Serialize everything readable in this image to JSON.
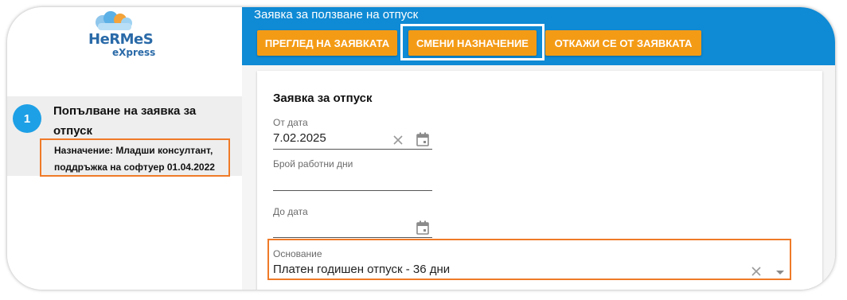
{
  "logo": {
    "name": "HeRMeS",
    "sub": "eXpress"
  },
  "sidebar": {
    "step_number": "1",
    "step_title": "Попълване на заявка за отпуск",
    "assignment_line1": "Назначение: Младши консултант,",
    "assignment_line2": "поддръжка на софтуер 01.04.2022"
  },
  "header": {
    "title": "Заявка за ползване на отпуск",
    "buttons": {
      "review": "ПРЕГЛЕД НА ЗАЯВКАТА",
      "change": "СМЕНИ НАЗНАЧЕНИЕ",
      "cancel": "ОТКАЖИ СЕ ОТ ЗАЯВКАТА"
    }
  },
  "form": {
    "title": "Заявка за отпуск",
    "from_date": {
      "label": "От дата",
      "value": "7.02.2025"
    },
    "work_days": {
      "label": "Брой работни дни",
      "value": ""
    },
    "to_date": {
      "label": "До дата",
      "value": ""
    },
    "basis": {
      "label": "Основание",
      "value": "Платен годишен отпуск - 36 дни"
    }
  },
  "colors": {
    "accent_blue": "#0f8ad4",
    "button_orange": "#f49b16",
    "highlight_orange": "#ef7a27",
    "step_blue": "#1ea0e6"
  },
  "icons": [
    "clear-icon",
    "calendar-icon",
    "dropdown-arrow-icon"
  ]
}
